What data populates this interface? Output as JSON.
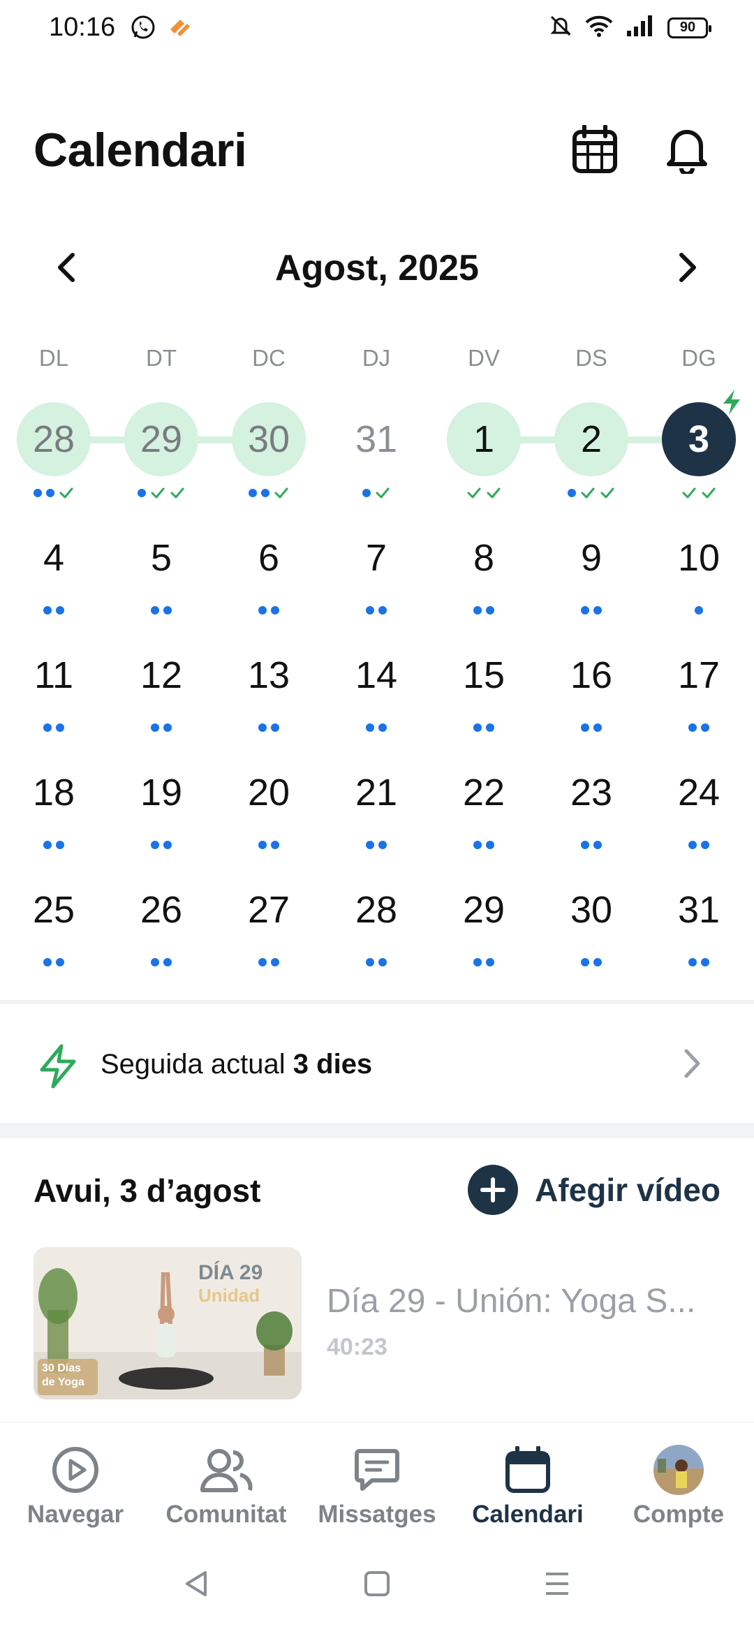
{
  "status_bar": {
    "time": "10:16",
    "battery": "90",
    "left_icons": [
      "whatsapp-icon",
      "app-notification-icon"
    ],
    "right_icons": [
      "mute-bell-icon",
      "wifi-icon",
      "signal-icon",
      "battery-icon"
    ]
  },
  "header": {
    "title": "Calendari",
    "icons": [
      "calendar-icon",
      "bell-icon"
    ]
  },
  "month_nav": {
    "label": "Agost, 2025",
    "prev_icon": "chevron-left-icon",
    "next_icon": "chevron-right-icon"
  },
  "weekdays": [
    "DL",
    "DT",
    "DC",
    "DJ",
    "DV",
    "DS",
    "DG"
  ],
  "calendar": {
    "weeks": [
      [
        {
          "day": "28",
          "state": "streak",
          "dots": 2,
          "checks": 1
        },
        {
          "day": "29",
          "state": "streak",
          "dots": 1,
          "checks": 2
        },
        {
          "day": "30",
          "state": "streak",
          "dots": 2,
          "checks": 1
        },
        {
          "day": "31",
          "state": "outside",
          "dots": 1,
          "checks": 1
        },
        {
          "day": "1",
          "state": "streak-done",
          "dots": 0,
          "checks": 2
        },
        {
          "day": "2",
          "state": "streak-done",
          "dots": 1,
          "checks": 2
        },
        {
          "day": "3",
          "state": "today",
          "dots": 0,
          "checks": 2
        }
      ],
      [
        {
          "day": "4",
          "dots": 2,
          "checks": 0
        },
        {
          "day": "5",
          "dots": 2,
          "checks": 0
        },
        {
          "day": "6",
          "dots": 2,
          "checks": 0
        },
        {
          "day": "7",
          "dots": 2,
          "checks": 0
        },
        {
          "day": "8",
          "dots": 2,
          "checks": 0
        },
        {
          "day": "9",
          "dots": 2,
          "checks": 0
        },
        {
          "day": "10",
          "dots": 1,
          "checks": 0
        }
      ],
      [
        {
          "day": "11",
          "dots": 2,
          "checks": 0
        },
        {
          "day": "12",
          "dots": 2,
          "checks": 0
        },
        {
          "day": "13",
          "dots": 2,
          "checks": 0
        },
        {
          "day": "14",
          "dots": 2,
          "checks": 0
        },
        {
          "day": "15",
          "dots": 2,
          "checks": 0
        },
        {
          "day": "16",
          "dots": 2,
          "checks": 0
        },
        {
          "day": "17",
          "dots": 2,
          "checks": 0
        }
      ],
      [
        {
          "day": "18",
          "dots": 2,
          "checks": 0
        },
        {
          "day": "19",
          "dots": 2,
          "checks": 0
        },
        {
          "day": "20",
          "dots": 2,
          "checks": 0
        },
        {
          "day": "21",
          "dots": 2,
          "checks": 0
        },
        {
          "day": "22",
          "dots": 2,
          "checks": 0
        },
        {
          "day": "23",
          "dots": 2,
          "checks": 0
        },
        {
          "day": "24",
          "dots": 2,
          "checks": 0
        }
      ],
      [
        {
          "day": "25",
          "dots": 2,
          "checks": 0
        },
        {
          "day": "26",
          "dots": 2,
          "checks": 0
        },
        {
          "day": "27",
          "dots": 2,
          "checks": 0
        },
        {
          "day": "28",
          "dots": 2,
          "checks": 0
        },
        {
          "day": "29",
          "dots": 2,
          "checks": 0
        },
        {
          "day": "30",
          "dots": 2,
          "checks": 0
        },
        {
          "day": "31",
          "dots": 2,
          "checks": 0
        }
      ]
    ],
    "today_badge_icon": "lightning-icon"
  },
  "streak": {
    "icon": "lightning-icon",
    "prefix": "Seguida actual",
    "value": "3 dies",
    "chevron_icon": "chevron-right-icon"
  },
  "today_section": {
    "title": "Avui, 3 d’agost",
    "add_label": "Afegir vídeo",
    "add_icon": "plus-icon",
    "video": {
      "title": "Día 29 - Unión: Yoga S...",
      "duration": "40:23",
      "thumb_title_line1": "DÍA 29",
      "thumb_title_line2": "Unidad",
      "thumb_badge_line1": "30 Días",
      "thumb_badge_line2": "de Yoga"
    }
  },
  "bottom_nav": {
    "items": [
      {
        "label": "Navegar",
        "icon": "play-circle-icon"
      },
      {
        "label": "Comunitat",
        "icon": "users-icon"
      },
      {
        "label": "Missatges",
        "icon": "chat-icon"
      },
      {
        "label": "Calendari",
        "icon": "calendar-icon",
        "active": true
      },
      {
        "label": "Compte",
        "icon": "avatar-icon"
      }
    ]
  },
  "colors": {
    "accent_dark": "#1f3347",
    "streak_bg": "#d5f1df",
    "dot_blue": "#1a73e8",
    "check_green": "#2eaa5c"
  }
}
